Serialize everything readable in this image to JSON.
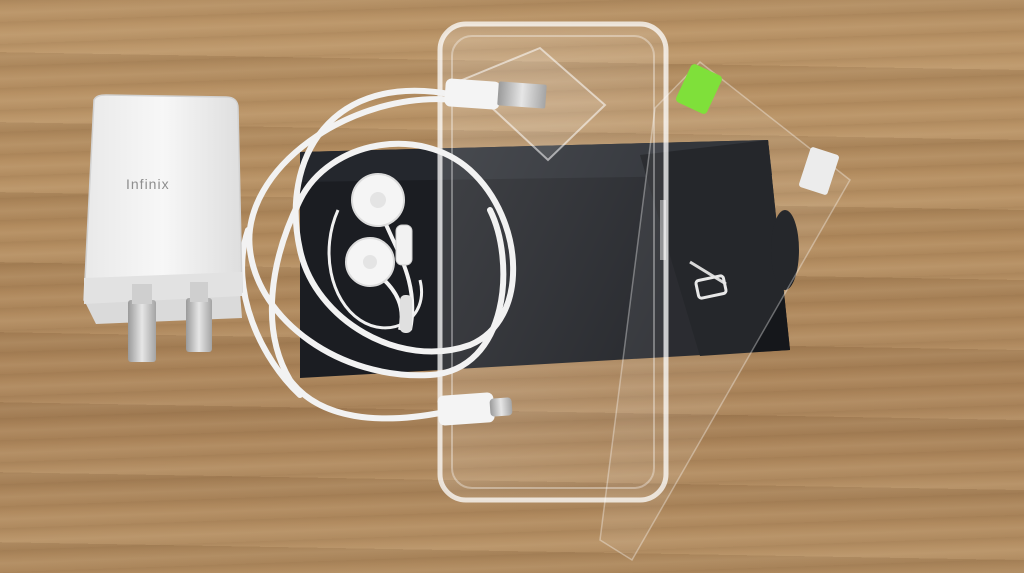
{
  "photo": {
    "charger_brand": "Infinix"
  }
}
